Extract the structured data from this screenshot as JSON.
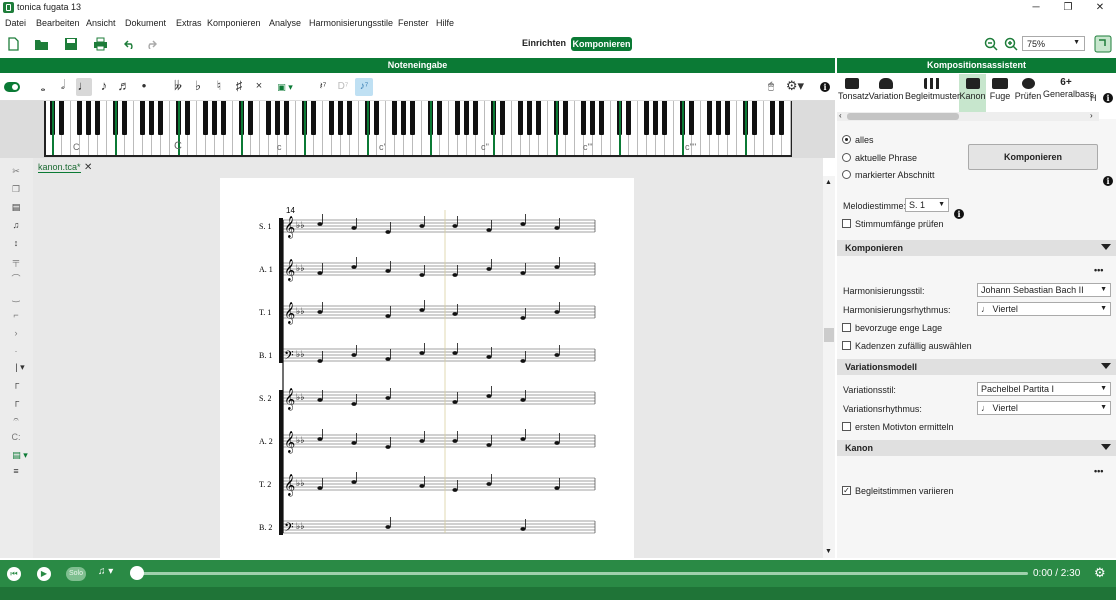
{
  "window": {
    "title": "tonica fugata 13",
    "minimize": "─",
    "maximize": "❐",
    "close": "✕"
  },
  "menu": [
    "Datei",
    "Bearbeiten",
    "Ansicht",
    "Dokument",
    "Extras",
    "Komponieren",
    "Analyse",
    "Harmonisierungsstile",
    "Fenster",
    "Hilfe"
  ],
  "toolbar": {
    "einrichten": "Einrichten",
    "komponieren": "Komponieren",
    "zoom": "75%"
  },
  "panels": {
    "noteneingabe": "Noteneingabe",
    "kompositionsassistent": "Kompositionsassistent"
  },
  "piano": {
    "labels": [
      "C",
      "C",
      "c",
      "c'",
      "c''",
      "c'''",
      "c''''"
    ]
  },
  "document": {
    "tab": "kanon.tca*",
    "measure_number": "14",
    "staves": [
      {
        "label": "S. 1",
        "clef": "treble"
      },
      {
        "label": "A. 1",
        "clef": "treble"
      },
      {
        "label": "T. 1",
        "clef": "treble8"
      },
      {
        "label": "B. 1",
        "clef": "bass"
      },
      {
        "label": "S. 2",
        "clef": "treble"
      },
      {
        "label": "A. 2",
        "clef": "treble"
      },
      {
        "label": "T. 2",
        "clef": "treble8"
      },
      {
        "label": "B. 2",
        "clef": "bass"
      }
    ]
  },
  "assistant": {
    "tabs": [
      "Tonsatz",
      "Variation",
      "Begleitmuster",
      "Kanon",
      "Fuge",
      "Prüfen",
      "Generalbass",
      "H"
    ],
    "generalbass_figure": "6+",
    "scope": {
      "options": [
        "alles",
        "aktuelle Phrase",
        "markierter Abschnitt"
      ],
      "selected": 0,
      "button": "Komponieren"
    },
    "melodiestimme_label": "Melodiestimme:",
    "melodiestimme_value": "S. 1",
    "stimmumfaenge": "Stimmumfänge prüfen",
    "sections": {
      "komponieren": {
        "title": "Komponieren",
        "stil_label": "Harmonisierungsstil:",
        "stil_value": "Johann Sebastian Bach II",
        "rhythmus_label": "Harmonisierungsrhythmus:",
        "rhythmus_value": "♩ Viertel",
        "enge_lage": "bevorzuge enge Lage",
        "kadenzen": "Kadenzen zufällig auswählen"
      },
      "variationsmodell": {
        "title": "Variationsmodell",
        "stil_label": "Variationsstil:",
        "stil_value": "Pachelbel Partita I",
        "rhythmus_label": "Variationsrhythmus:",
        "rhythmus_value": "♩ Viertel",
        "motivton": "ersten Motivton ermitteln"
      },
      "kanon": {
        "title": "Kanon",
        "begleitstimmen": "Begleitstimmen variieren",
        "begleitstimmen_checked": true
      }
    },
    "more": "•••"
  },
  "player": {
    "solo": "Solo",
    "time": "0:00 / 2:30",
    "progress": 0.0
  },
  "colors": {
    "brand_green": "#0b7a35",
    "player_green": "#2a8a45"
  }
}
